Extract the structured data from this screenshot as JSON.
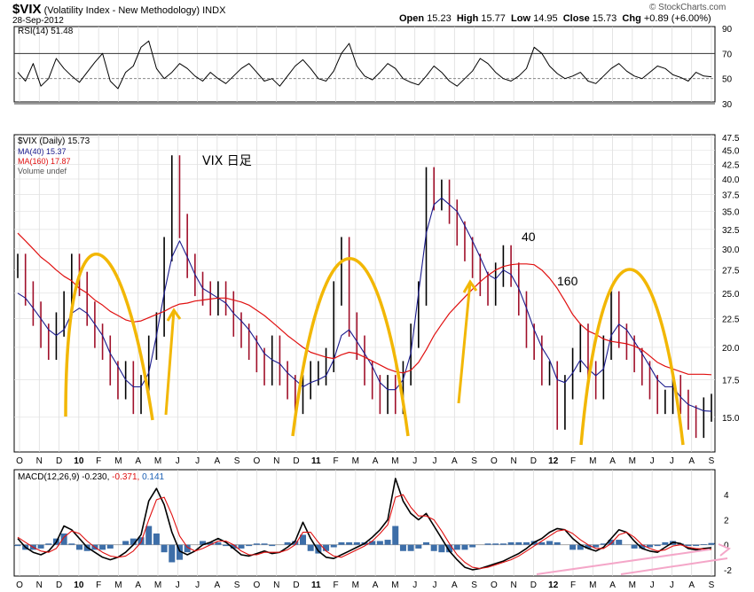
{
  "header": {
    "symbol": "$VIX",
    "description": "(Volatility Index - New Methodology)",
    "exchange": "INDX",
    "date": "28-Sep-2012",
    "watermark": "© StockCharts.com",
    "quote": {
      "open_label": "Open",
      "open": "15.23",
      "high_label": "High",
      "high": "15.77",
      "low_label": "Low",
      "low": "14.95",
      "close_label": "Close",
      "close": "15.73",
      "chg_label": "Chg",
      "chg": "+0.89 (+6.00%)"
    }
  },
  "chart_data": [
    {
      "type": "line",
      "panel": "rsi",
      "legend": "RSI(14) 51.48",
      "ylim": [
        30,
        90
      ],
      "y_ticks": [
        "90",
        "70",
        "50",
        "30"
      ],
      "reference_lines": [
        70,
        50,
        30
      ],
      "series": [
        {
          "name": "RSI(14)",
          "values": [
            55,
            48,
            62,
            44,
            50,
            66,
            58,
            52,
            47,
            55,
            63,
            70,
            48,
            42,
            55,
            60,
            75,
            80,
            58,
            50,
            55,
            62,
            58,
            52,
            48,
            55,
            50,
            46,
            52,
            58,
            62,
            55,
            48,
            50,
            44,
            52,
            60,
            65,
            58,
            50,
            48,
            56,
            70,
            78,
            60,
            52,
            49,
            55,
            62,
            58,
            50,
            47,
            45,
            52,
            60,
            55,
            48,
            44,
            50,
            56,
            66,
            62,
            55,
            50,
            48,
            52,
            58,
            75,
            70,
            60,
            54,
            50,
            52,
            55,
            48,
            46,
            52,
            58,
            62,
            56,
            52,
            50,
            55,
            60,
            58,
            53,
            51,
            48,
            55,
            52,
            51.48
          ]
        }
      ]
    },
    {
      "type": "line",
      "panel": "price",
      "title": "VIX 日足",
      "legend": [
        "$VIX (Daily) 15.73",
        "MA(40) 15.37",
        "MA(160) 17.87",
        "Volume undef"
      ],
      "ylim": [
        13.0,
        48.0
      ],
      "log_scale": true,
      "y_ticks": [
        "47.5",
        "45.0",
        "42.5",
        "40.0",
        "37.5",
        "35.0",
        "32.5",
        "30.0",
        "27.5",
        "25.0",
        "22.5",
        "20.0",
        "17.5",
        "15.0"
      ],
      "x_ticks": [
        "O",
        "N",
        "D",
        "10",
        "F",
        "M",
        "A",
        "M",
        "J",
        "J",
        "A",
        "S",
        "O",
        "N",
        "D",
        "11",
        "F",
        "M",
        "A",
        "M",
        "J",
        "J",
        "A",
        "S",
        "O",
        "N",
        "D",
        "12",
        "F",
        "M",
        "A",
        "M",
        "J",
        "J",
        "A",
        "S"
      ],
      "annotations": [
        "40",
        "160"
      ],
      "series": [
        {
          "name": "$VIX",
          "values": [
            28,
            25,
            23,
            21,
            20,
            22,
            24,
            28,
            26,
            23,
            21,
            20,
            18,
            17,
            18,
            16,
            17,
            20,
            22,
            30,
            42,
            33,
            28,
            26,
            25,
            24,
            25,
            24,
            22,
            21,
            20,
            19,
            18,
            20,
            18,
            17,
            16,
            17,
            18,
            18,
            19,
            25,
            30,
            22,
            20,
            18,
            17,
            16,
            17,
            16,
            18,
            21,
            25,
            40,
            37,
            38,
            35,
            32,
            30,
            28,
            26,
            25,
            27,
            29,
            27,
            24,
            21,
            20,
            18,
            18,
            15,
            17,
            19,
            21,
            18,
            17,
            20,
            24,
            21,
            20,
            19,
            18,
            17,
            16,
            16,
            17,
            16,
            15,
            14.5,
            15.5,
            15.73
          ]
        },
        {
          "name": "MA(40)",
          "values": [
            25,
            24.5,
            23.5,
            22.5,
            21.5,
            21,
            21.5,
            23,
            23.5,
            23,
            22,
            21,
            19.5,
            18.5,
            17.5,
            17,
            17,
            18,
            21,
            25,
            29,
            31,
            29,
            27,
            25.5,
            25,
            24.5,
            24,
            23,
            22.3,
            21.5,
            20.5,
            19.5,
            19,
            18.7,
            18,
            17.5,
            17,
            17.3,
            17.5,
            17.8,
            19,
            21,
            21.5,
            20.5,
            19.5,
            18.5,
            17.3,
            16.8,
            16.8,
            17.5,
            19.5,
            25,
            32,
            36,
            37,
            36,
            35,
            33,
            31,
            29,
            27,
            26.5,
            27.5,
            27,
            25.5,
            23.5,
            21.5,
            20,
            19,
            17.5,
            17.3,
            18,
            19,
            18.3,
            17.8,
            18.3,
            21,
            22,
            21.5,
            20.5,
            19.5,
            18.5,
            17.5,
            17,
            17,
            16.3,
            15.8,
            15.6,
            15.4,
            15.37
          ]
        },
        {
          "name": "MA(160)",
          "values": [
            32,
            31,
            30,
            29,
            28.3,
            27.5,
            26.8,
            26.3,
            25.5,
            25,
            24.3,
            23.8,
            23.2,
            22.8,
            22.4,
            22.2,
            22.3,
            22.6,
            22.9,
            23.2,
            23.6,
            23.9,
            24,
            24.2,
            24.3,
            24.4,
            24.5,
            24.5,
            24.3,
            24.1,
            23.8,
            23.3,
            22.8,
            22.2,
            21.6,
            21,
            20.5,
            20,
            19.6,
            19.4,
            19.2,
            19.1,
            19.4,
            19.6,
            19.5,
            19.2,
            18.9,
            18.6,
            18.3,
            18.1,
            18,
            18.2,
            18.8,
            19.8,
            21,
            22,
            23,
            23.8,
            24.6,
            25.4,
            26.2,
            26.9,
            27.5,
            27.9,
            28.1,
            28.2,
            28.2,
            28.1,
            27.5,
            26.6,
            25.5,
            24.2,
            22.9,
            22,
            21.4,
            21.1,
            20.7,
            20.5,
            20.4,
            20.3,
            20.1,
            19.8,
            19.3,
            18.8,
            18.5,
            18.3,
            18.1,
            17.9,
            17.9,
            17.9,
            17.87
          ]
        }
      ]
    },
    {
      "type": "line",
      "panel": "macd",
      "legend_prefix": "MACD(12,26,9)",
      "legend_values": [
        "-0.230",
        "-0.371",
        "0.141"
      ],
      "ylim": [
        -2.5,
        6
      ],
      "y_ticks": [
        "4",
        "2",
        "0",
        "-2"
      ],
      "x_ticks": [
        "O",
        "N",
        "D",
        "10",
        "F",
        "M",
        "A",
        "M",
        "J",
        "J",
        "A",
        "S",
        "O",
        "N",
        "D",
        "11",
        "F",
        "M",
        "A",
        "M",
        "J",
        "J",
        "A",
        "S",
        "O",
        "N",
        "D",
        "12",
        "F",
        "M",
        "A",
        "M",
        "J",
        "J",
        "A",
        "S"
      ],
      "series": [
        {
          "name": "MACD",
          "values": [
            0.5,
            -0.2,
            -0.6,
            -0.8,
            -0.5,
            0.2,
            1.5,
            1.2,
            0.5,
            -0.2,
            -0.6,
            -1,
            -1.2,
            -1,
            -0.6,
            0,
            0.8,
            3.5,
            4.5,
            3.2,
            1,
            -0.5,
            -0.8,
            -0.5,
            0,
            0.2,
            0.5,
            0.2,
            -0.3,
            -0.8,
            -0.9,
            -0.7,
            -0.5,
            -0.7,
            -0.6,
            -0.2,
            0.3,
            1.8,
            0.5,
            -0.5,
            -1,
            -1.1,
            -0.8,
            -0.5,
            -0.2,
            0.1,
            0.6,
            1.2,
            2,
            5.3,
            3.5,
            2.5,
            2,
            2.5,
            1.5,
            0.5,
            -0.5,
            -1.2,
            -1.8,
            -2,
            -1.9,
            -1.7,
            -1.5,
            -1.3,
            -1,
            -0.7,
            -0.3,
            0.2,
            0.5,
            1,
            1.3,
            1.2,
            0.5,
            0,
            -0.3,
            -0.5,
            -0.2,
            0.5,
            1.2,
            1,
            0.3,
            -0.3,
            -0.5,
            -0.6,
            -0.2,
            0.2,
            0.1,
            -0.3,
            -0.4,
            -0.3,
            -0.23
          ]
        },
        {
          "name": "Signal",
          "values": [
            0.6,
            0.2,
            -0.2,
            -0.5,
            -0.6,
            -0.3,
            0.6,
            1.1,
            0.9,
            0.3,
            -0.2,
            -0.6,
            -0.9,
            -1,
            -0.9,
            -0.5,
            0.2,
            2,
            3.6,
            3.8,
            2.4,
            0.7,
            -0.2,
            -0.5,
            -0.3,
            0,
            0.3,
            0.3,
            0,
            -0.5,
            -0.8,
            -0.8,
            -0.6,
            -0.6,
            -0.6,
            -0.4,
            0,
            1,
            1,
            0.2,
            -0.5,
            -0.9,
            -1,
            -0.7,
            -0.4,
            -0.1,
            0.3,
            0.9,
            1.6,
            3.8,
            4,
            3,
            2.3,
            2.3,
            2,
            1.1,
            0.1,
            -0.8,
            -1.4,
            -1.8,
            -1.9,
            -1.8,
            -1.6,
            -1.4,
            -1.2,
            -0.9,
            -0.5,
            -0.1,
            0.3,
            0.7,
            1.1,
            1.2,
            0.9,
            0.4,
            0,
            -0.3,
            -0.3,
            0.1,
            0.8,
            1,
            0.6,
            0,
            -0.3,
            -0.5,
            -0.4,
            -0.1,
            0,
            -0.2,
            -0.3,
            -0.35,
            -0.371
          ]
        }
      ]
    }
  ]
}
